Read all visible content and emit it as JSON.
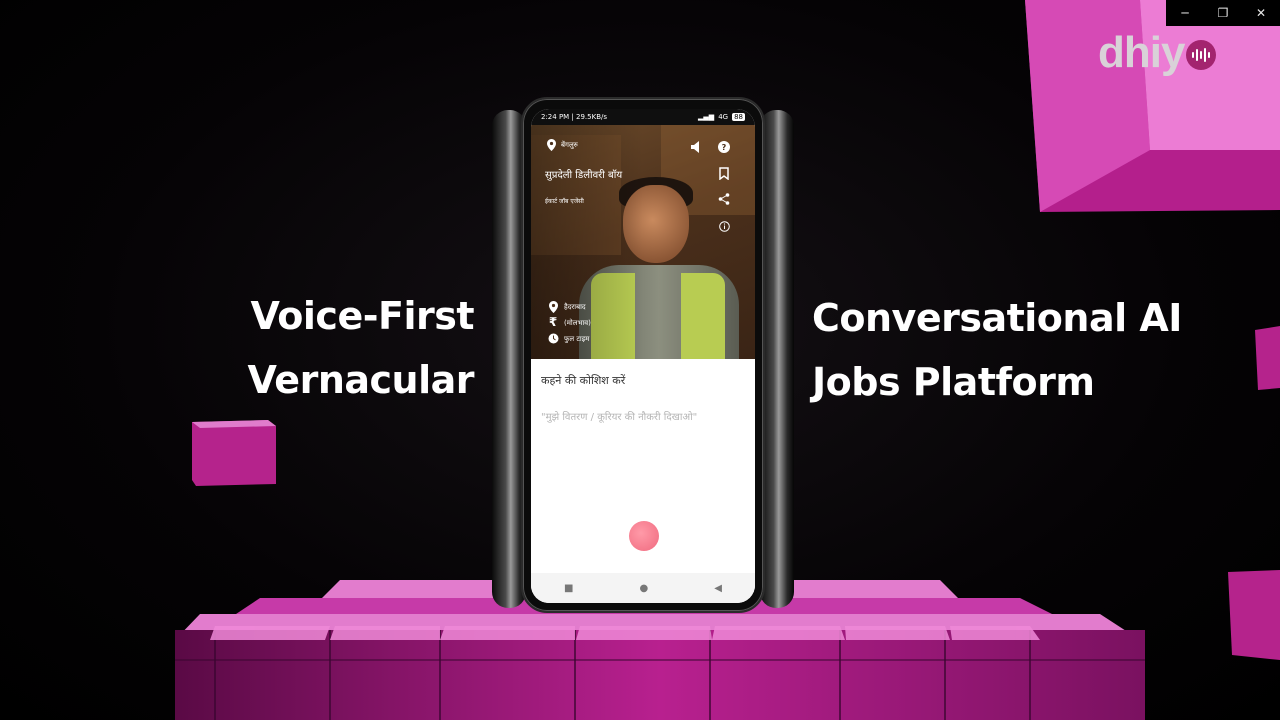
{
  "window_controls": {
    "minimize_glyph": "─",
    "restore_glyph": "❐",
    "close_glyph": "✕"
  },
  "logo": {
    "text": "dhiy"
  },
  "headings": {
    "left_line1": "Voice-First",
    "left_line2": "Vernacular",
    "right_line1": "Conversational AI",
    "right_line2": "Jobs Platform"
  },
  "phone": {
    "status_bar": {
      "time": "2:24 PM | 29.5KB/s",
      "right": "4G",
      "battery": "88"
    },
    "job_card": {
      "location": "बेंगलुरु",
      "title": "सुप्रदेली डिलीवरी बॉय",
      "company": "ईकार्ट जॉब एजेंसी",
      "city": "हैदराबाद",
      "salary": "(मोलभाव)",
      "job_type": "फुल टाइम"
    },
    "icons": {
      "location": "location-pin-icon",
      "speaker": "speaker-icon",
      "help": "help-icon",
      "bookmark": "bookmark-icon",
      "share": "share-icon",
      "info": "info-icon",
      "rupee": "rupee-icon",
      "clock": "clock-icon",
      "mic": "microphone-icon"
    },
    "prompt": {
      "title": "कहने की कोशिश करें",
      "example": "\"मुझे वितरण / कूरियर की नौकरी दिखाओ\""
    },
    "navbar": {
      "recents": "■",
      "home": "●",
      "back": "◀"
    }
  },
  "colors": {
    "accent_magenta": "#c21f9a",
    "mic_pink": "#f06a7f",
    "logo_mark": "#a3246f"
  }
}
